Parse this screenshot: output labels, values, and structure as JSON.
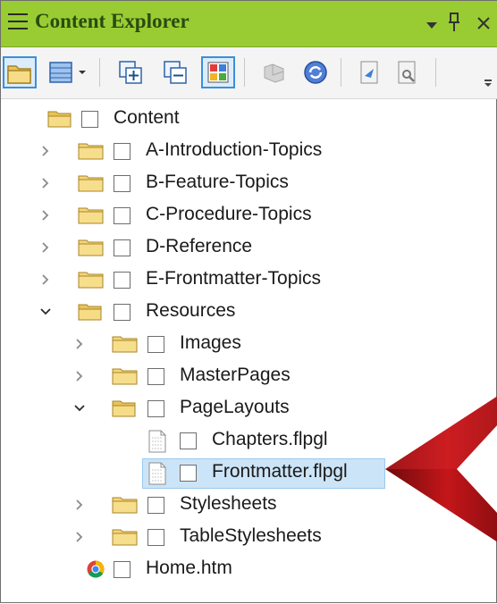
{
  "panel": {
    "title": "Content Explorer",
    "accent_color": "#99cc33"
  },
  "toolbar": {
    "buttons": [
      "open-folder-icon",
      "view-mode-icon",
      "expand-all-icon",
      "collapse-all-icon",
      "color-grid-icon",
      "disabled-bind-icon",
      "sync-icon",
      "properties-icon",
      "settings-icon"
    ]
  },
  "tree": {
    "root": {
      "label": "Content",
      "icon": "open-folder-icon"
    },
    "items": [
      {
        "label": "A-Introduction-Topics",
        "icon": "folder-icon",
        "state": "collapsed"
      },
      {
        "label": "B-Feature-Topics",
        "icon": "folder-icon",
        "state": "collapsed"
      },
      {
        "label": "C-Procedure-Topics",
        "icon": "folder-icon",
        "state": "collapsed"
      },
      {
        "label": "D-Reference",
        "icon": "folder-icon",
        "state": "collapsed"
      },
      {
        "label": "E-Frontmatter-Topics",
        "icon": "folder-icon",
        "state": "collapsed"
      },
      {
        "label": "Resources",
        "icon": "open-folder-icon",
        "state": "expanded"
      },
      {
        "label": "Images",
        "icon": "folder-icon",
        "state": "collapsed"
      },
      {
        "label": "MasterPages",
        "icon": "folder-icon",
        "state": "collapsed"
      },
      {
        "label": "PageLayouts",
        "icon": "open-folder-icon",
        "state": "expanded"
      },
      {
        "label": "Chapters.flpgl",
        "icon": "page-layout-file-icon",
        "state": "leaf"
      },
      {
        "label": "Frontmatter.flpgl",
        "icon": "page-layout-file-icon",
        "state": "leaf-selected"
      },
      {
        "label": "Stylesheets",
        "icon": "folder-icon",
        "state": "collapsed"
      },
      {
        "label": "TableStylesheets",
        "icon": "folder-icon",
        "state": "collapsed"
      },
      {
        "label": "Home.htm",
        "icon": "chrome-html-icon",
        "state": "leaf"
      }
    ]
  },
  "selection_color": "#cce4f7",
  "pointer_color": "#b01416"
}
